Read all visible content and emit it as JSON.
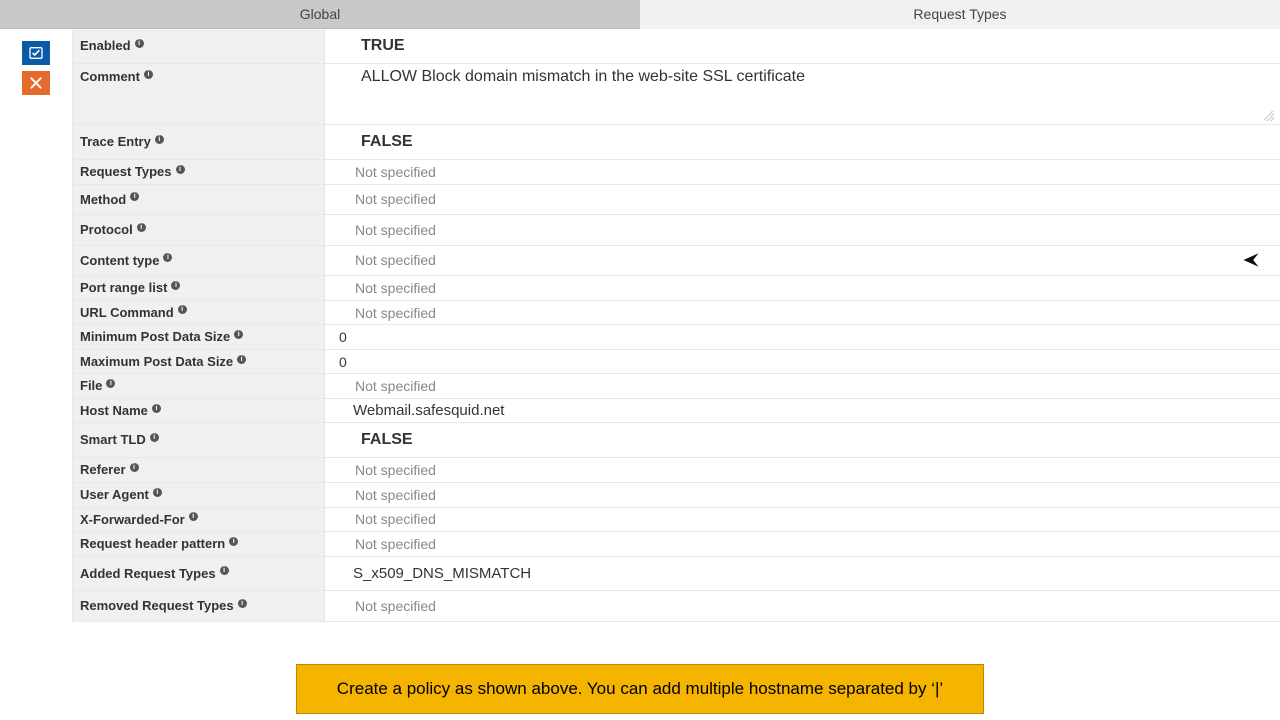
{
  "tabs": {
    "global": "Global",
    "request_types": "Request Types"
  },
  "rows": {
    "enabled": {
      "label": "Enabled",
      "value": "TRUE"
    },
    "comment": {
      "label": "Comment",
      "value": "ALLOW Block domain mismatch in the web-site SSL certificate"
    },
    "trace_entry": {
      "label": "Trace Entry",
      "value": "FALSE"
    },
    "request_types": {
      "label": "Request Types",
      "value": "Not specified"
    },
    "method": {
      "label": "Method",
      "value": "Not specified"
    },
    "protocol": {
      "label": "Protocol",
      "value": "Not specified"
    },
    "content_type": {
      "label": "Content type",
      "value": "Not specified"
    },
    "port_range": {
      "label": "Port range list",
      "value": "Not specified"
    },
    "url_command": {
      "label": "URL Command",
      "value": "Not specified"
    },
    "min_post": {
      "label": "Minimum Post Data Size",
      "value": "0"
    },
    "max_post": {
      "label": "Maximum Post Data Size",
      "value": "0"
    },
    "file": {
      "label": "File",
      "value": "Not specified"
    },
    "host_name": {
      "label": "Host Name",
      "value": "Webmail.safesquid.net"
    },
    "smart_tld": {
      "label": "Smart TLD",
      "value": "FALSE"
    },
    "referer": {
      "label": "Referer",
      "value": "Not specified"
    },
    "user_agent": {
      "label": "User Agent",
      "value": "Not specified"
    },
    "x_forwarded": {
      "label": "X-Forwarded-For",
      "value": "Not specified"
    },
    "req_header": {
      "label": "Request header pattern",
      "value": "Not specified"
    },
    "added_req": {
      "label": "Added Request Types",
      "value": "S_x509_DNS_MISMATCH"
    },
    "removed_req": {
      "label": "Removed Request Types",
      "value": "Not specified"
    }
  },
  "banner": "Create a policy as shown above. You can add multiple hostname separated by ‘|’"
}
